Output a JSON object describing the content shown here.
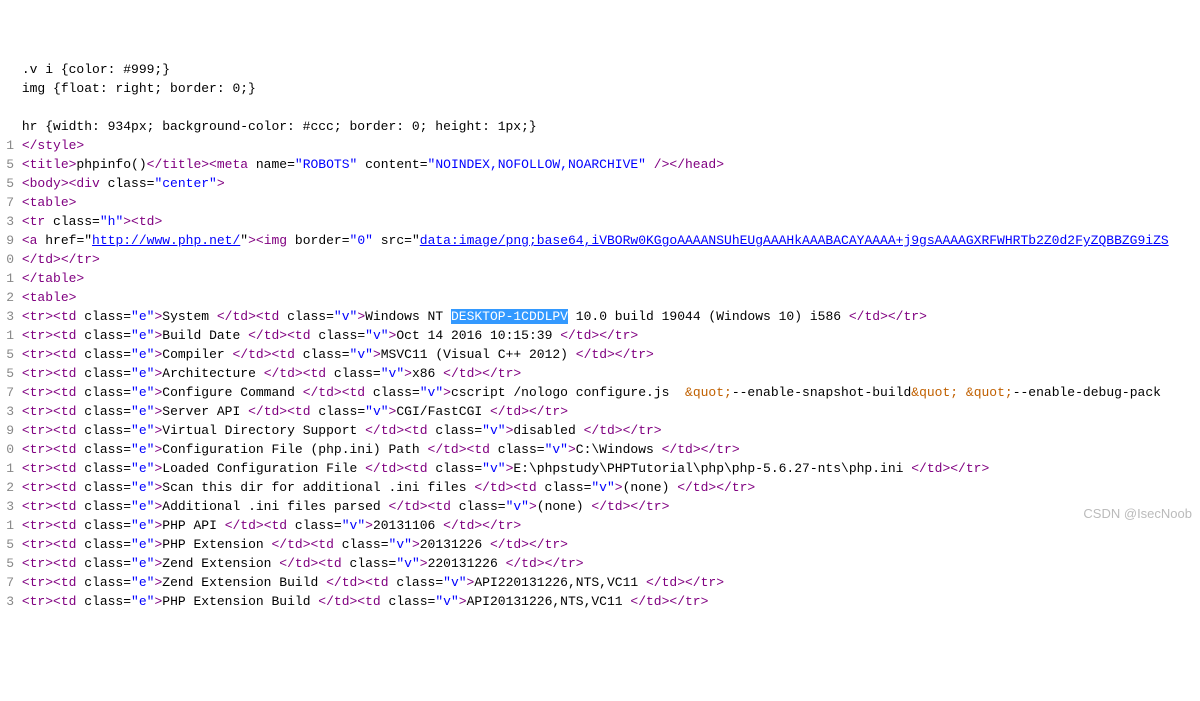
{
  "watermark": "CSDN @IsecNoob",
  "selected_text": "DESKTOP-1CDDLPV",
  "lines": [
    {
      "g": "",
      "parts": [
        {
          "c": "txt",
          "t": ".v i {color: #999;}"
        }
      ]
    },
    {
      "g": "",
      "parts": [
        {
          "c": "txt",
          "t": "img {float: right; border: 0;}"
        }
      ]
    },
    {
      "g": "",
      "parts": []
    },
    {
      "g": "",
      "parts": [
        {
          "c": "txt",
          "t": "hr {width: 934px; background-color: #ccc; border: 0; height: 1px;}"
        }
      ]
    },
    {
      "g": "1",
      "parts": [
        {
          "c": "tag",
          "t": "</style>"
        }
      ]
    },
    {
      "g": "5",
      "parts": [
        {
          "c": "tag",
          "t": "<title>"
        },
        {
          "c": "txt",
          "t": "phpinfo()"
        },
        {
          "c": "tag",
          "t": "</title><meta"
        },
        {
          "c": "attr-name",
          "t": " name"
        },
        {
          "c": "txt",
          "t": "="
        },
        {
          "c": "attr-val",
          "t": "\"ROBOTS\""
        },
        {
          "c": "attr-name",
          "t": " content"
        },
        {
          "c": "txt",
          "t": "="
        },
        {
          "c": "attr-val",
          "t": "\"NOINDEX,NOFOLLOW,NOARCHIVE\""
        },
        {
          "c": "tag",
          "t": " /></head>"
        }
      ]
    },
    {
      "g": "5",
      "parts": [
        {
          "c": "tag",
          "t": "<body><div"
        },
        {
          "c": "attr-name",
          "t": " class"
        },
        {
          "c": "txt",
          "t": "="
        },
        {
          "c": "attr-val",
          "t": "\"center\""
        },
        {
          "c": "tag",
          "t": ">"
        }
      ]
    },
    {
      "g": "7",
      "parts": [
        {
          "c": "tag",
          "t": "<table>"
        }
      ]
    },
    {
      "g": "3",
      "parts": [
        {
          "c": "tag",
          "t": "<tr"
        },
        {
          "c": "attr-name",
          "t": " class"
        },
        {
          "c": "txt",
          "t": "="
        },
        {
          "c": "attr-val",
          "t": "\"h\""
        },
        {
          "c": "tag",
          "t": "><td>"
        }
      ]
    },
    {
      "g": "9",
      "parts": [
        {
          "c": "tag",
          "t": "<a"
        },
        {
          "c": "attr-name",
          "t": " href"
        },
        {
          "c": "txt",
          "t": "=\""
        },
        {
          "c": "link",
          "t": "http://www.php.net/"
        },
        {
          "c": "txt",
          "t": "\""
        },
        {
          "c": "tag",
          "t": "><img"
        },
        {
          "c": "attr-name",
          "t": " border"
        },
        {
          "c": "txt",
          "t": "="
        },
        {
          "c": "attr-val",
          "t": "\"0\""
        },
        {
          "c": "attr-name",
          "t": " src"
        },
        {
          "c": "txt",
          "t": "=\""
        },
        {
          "c": "link",
          "t": "data:image/png;base64,iVBORw0KGgoAAAANSUhEUgAAAHkAAABACAYAAAA+j9gsAAAAGXRFWHRTb2Z0d2FyZQBBZG9iZS"
        }
      ]
    },
    {
      "g": "0",
      "parts": [
        {
          "c": "tag",
          "t": "</td></tr>"
        }
      ]
    },
    {
      "g": "1",
      "parts": [
        {
          "c": "tag",
          "t": "</table>"
        }
      ]
    },
    {
      "g": "2",
      "parts": [
        {
          "c": "tag",
          "t": "<table>"
        }
      ]
    },
    {
      "g": "3",
      "parts": [
        {
          "c": "tag",
          "t": "<tr><td"
        },
        {
          "c": "attr-name",
          "t": " class"
        },
        {
          "c": "txt",
          "t": "="
        },
        {
          "c": "attr-val",
          "t": "\"e\""
        },
        {
          "c": "tag",
          "t": ">"
        },
        {
          "c": "txt",
          "t": "System "
        },
        {
          "c": "tag",
          "t": "</td><td"
        },
        {
          "c": "attr-name",
          "t": " class"
        },
        {
          "c": "txt",
          "t": "="
        },
        {
          "c": "attr-val",
          "t": "\"v\""
        },
        {
          "c": "tag",
          "t": ">"
        },
        {
          "c": "txt",
          "t": "Windows NT "
        },
        {
          "c": "sel",
          "t": "DESKTOP-1CDDLPV"
        },
        {
          "c": "txt",
          "t": " 10.0 build 19044 (Windows 10) i586 "
        },
        {
          "c": "tag",
          "t": "</td></tr>"
        }
      ]
    },
    {
      "g": "1",
      "parts": [
        {
          "c": "tag",
          "t": "<tr><td"
        },
        {
          "c": "attr-name",
          "t": " class"
        },
        {
          "c": "txt",
          "t": "="
        },
        {
          "c": "attr-val",
          "t": "\"e\""
        },
        {
          "c": "tag",
          "t": ">"
        },
        {
          "c": "txt",
          "t": "Build Date "
        },
        {
          "c": "tag",
          "t": "</td><td"
        },
        {
          "c": "attr-name",
          "t": " class"
        },
        {
          "c": "txt",
          "t": "="
        },
        {
          "c": "attr-val",
          "t": "\"v\""
        },
        {
          "c": "tag",
          "t": ">"
        },
        {
          "c": "txt",
          "t": "Oct 14 2016 10:15:39 "
        },
        {
          "c": "tag",
          "t": "</td></tr>"
        }
      ]
    },
    {
      "g": "5",
      "parts": [
        {
          "c": "tag",
          "t": "<tr><td"
        },
        {
          "c": "attr-name",
          "t": " class"
        },
        {
          "c": "txt",
          "t": "="
        },
        {
          "c": "attr-val",
          "t": "\"e\""
        },
        {
          "c": "tag",
          "t": ">"
        },
        {
          "c": "txt",
          "t": "Compiler "
        },
        {
          "c": "tag",
          "t": "</td><td"
        },
        {
          "c": "attr-name",
          "t": " class"
        },
        {
          "c": "txt",
          "t": "="
        },
        {
          "c": "attr-val",
          "t": "\"v\""
        },
        {
          "c": "tag",
          "t": ">"
        },
        {
          "c": "txt",
          "t": "MSVC11 (Visual C++ 2012) "
        },
        {
          "c": "tag",
          "t": "</td></tr>"
        }
      ]
    },
    {
      "g": "5",
      "parts": [
        {
          "c": "tag",
          "t": "<tr><td"
        },
        {
          "c": "attr-name",
          "t": " class"
        },
        {
          "c": "txt",
          "t": "="
        },
        {
          "c": "attr-val",
          "t": "\"e\""
        },
        {
          "c": "tag",
          "t": ">"
        },
        {
          "c": "txt",
          "t": "Architecture "
        },
        {
          "c": "tag",
          "t": "</td><td"
        },
        {
          "c": "attr-name",
          "t": " class"
        },
        {
          "c": "txt",
          "t": "="
        },
        {
          "c": "attr-val",
          "t": "\"v\""
        },
        {
          "c": "tag",
          "t": ">"
        },
        {
          "c": "txt",
          "t": "x86 "
        },
        {
          "c": "tag",
          "t": "</td></tr>"
        }
      ]
    },
    {
      "g": "7",
      "parts": [
        {
          "c": "tag",
          "t": "<tr><td"
        },
        {
          "c": "attr-name",
          "t": " class"
        },
        {
          "c": "txt",
          "t": "="
        },
        {
          "c": "attr-val",
          "t": "\"e\""
        },
        {
          "c": "tag",
          "t": ">"
        },
        {
          "c": "txt",
          "t": "Configure Command "
        },
        {
          "c": "tag",
          "t": "</td><td"
        },
        {
          "c": "attr-name",
          "t": " class"
        },
        {
          "c": "txt",
          "t": "="
        },
        {
          "c": "attr-val",
          "t": "\"v\""
        },
        {
          "c": "tag",
          "t": ">"
        },
        {
          "c": "txt",
          "t": "cscript /nologo configure.js  "
        },
        {
          "c": "ent",
          "t": "&quot;"
        },
        {
          "c": "txt",
          "t": "--enable-snapshot-build"
        },
        {
          "c": "ent",
          "t": "&quot;"
        },
        {
          "c": "txt",
          "t": " "
        },
        {
          "c": "ent",
          "t": "&quot;"
        },
        {
          "c": "txt",
          "t": "--enable-debug-pack"
        }
      ]
    },
    {
      "g": "3",
      "parts": [
        {
          "c": "tag",
          "t": "<tr><td"
        },
        {
          "c": "attr-name",
          "t": " class"
        },
        {
          "c": "txt",
          "t": "="
        },
        {
          "c": "attr-val",
          "t": "\"e\""
        },
        {
          "c": "tag",
          "t": ">"
        },
        {
          "c": "txt",
          "t": "Server API "
        },
        {
          "c": "tag",
          "t": "</td><td"
        },
        {
          "c": "attr-name",
          "t": " class"
        },
        {
          "c": "txt",
          "t": "="
        },
        {
          "c": "attr-val",
          "t": "\"v\""
        },
        {
          "c": "tag",
          "t": ">"
        },
        {
          "c": "txt",
          "t": "CGI/FastCGI "
        },
        {
          "c": "tag",
          "t": "</td></tr>"
        }
      ]
    },
    {
      "g": "9",
      "parts": [
        {
          "c": "tag",
          "t": "<tr><td"
        },
        {
          "c": "attr-name",
          "t": " class"
        },
        {
          "c": "txt",
          "t": "="
        },
        {
          "c": "attr-val",
          "t": "\"e\""
        },
        {
          "c": "tag",
          "t": ">"
        },
        {
          "c": "txt",
          "t": "Virtual Directory Support "
        },
        {
          "c": "tag",
          "t": "</td><td"
        },
        {
          "c": "attr-name",
          "t": " class"
        },
        {
          "c": "txt",
          "t": "="
        },
        {
          "c": "attr-val",
          "t": "\"v\""
        },
        {
          "c": "tag",
          "t": ">"
        },
        {
          "c": "txt",
          "t": "disabled "
        },
        {
          "c": "tag",
          "t": "</td></tr>"
        }
      ]
    },
    {
      "g": "0",
      "parts": [
        {
          "c": "tag",
          "t": "<tr><td"
        },
        {
          "c": "attr-name",
          "t": " class"
        },
        {
          "c": "txt",
          "t": "="
        },
        {
          "c": "attr-val",
          "t": "\"e\""
        },
        {
          "c": "tag",
          "t": ">"
        },
        {
          "c": "txt",
          "t": "Configuration File (php.ini) Path "
        },
        {
          "c": "tag",
          "t": "</td><td"
        },
        {
          "c": "attr-name",
          "t": " class"
        },
        {
          "c": "txt",
          "t": "="
        },
        {
          "c": "attr-val",
          "t": "\"v\""
        },
        {
          "c": "tag",
          "t": ">"
        },
        {
          "c": "txt",
          "t": "C:\\Windows "
        },
        {
          "c": "tag",
          "t": "</td></tr>"
        }
      ]
    },
    {
      "g": "1",
      "parts": [
        {
          "c": "tag",
          "t": "<tr><td"
        },
        {
          "c": "attr-name",
          "t": " class"
        },
        {
          "c": "txt",
          "t": "="
        },
        {
          "c": "attr-val",
          "t": "\"e\""
        },
        {
          "c": "tag",
          "t": ">"
        },
        {
          "c": "txt",
          "t": "Loaded Configuration File "
        },
        {
          "c": "tag",
          "t": "</td><td"
        },
        {
          "c": "attr-name",
          "t": " class"
        },
        {
          "c": "txt",
          "t": "="
        },
        {
          "c": "attr-val",
          "t": "\"v\""
        },
        {
          "c": "tag",
          "t": ">"
        },
        {
          "c": "txt",
          "t": "E:\\phpstudy\\PHPTutorial\\php\\php-5.6.27-nts\\php.ini "
        },
        {
          "c": "tag",
          "t": "</td></tr>"
        }
      ]
    },
    {
      "g": "2",
      "parts": [
        {
          "c": "tag",
          "t": "<tr><td"
        },
        {
          "c": "attr-name",
          "t": " class"
        },
        {
          "c": "txt",
          "t": "="
        },
        {
          "c": "attr-val",
          "t": "\"e\""
        },
        {
          "c": "tag",
          "t": ">"
        },
        {
          "c": "txt",
          "t": "Scan this dir for additional .ini files "
        },
        {
          "c": "tag",
          "t": "</td><td"
        },
        {
          "c": "attr-name",
          "t": " class"
        },
        {
          "c": "txt",
          "t": "="
        },
        {
          "c": "attr-val",
          "t": "\"v\""
        },
        {
          "c": "tag",
          "t": ">"
        },
        {
          "c": "txt",
          "t": "(none) "
        },
        {
          "c": "tag",
          "t": "</td></tr>"
        }
      ]
    },
    {
      "g": "3",
      "parts": [
        {
          "c": "tag",
          "t": "<tr><td"
        },
        {
          "c": "attr-name",
          "t": " class"
        },
        {
          "c": "txt",
          "t": "="
        },
        {
          "c": "attr-val",
          "t": "\"e\""
        },
        {
          "c": "tag",
          "t": ">"
        },
        {
          "c": "txt",
          "t": "Additional .ini files parsed "
        },
        {
          "c": "tag",
          "t": "</td><td"
        },
        {
          "c": "attr-name",
          "t": " class"
        },
        {
          "c": "txt",
          "t": "="
        },
        {
          "c": "attr-val",
          "t": "\"v\""
        },
        {
          "c": "tag",
          "t": ">"
        },
        {
          "c": "txt",
          "t": "(none) "
        },
        {
          "c": "tag",
          "t": "</td></tr>"
        }
      ]
    },
    {
      "g": "1",
      "parts": [
        {
          "c": "tag",
          "t": "<tr><td"
        },
        {
          "c": "attr-name",
          "t": " class"
        },
        {
          "c": "txt",
          "t": "="
        },
        {
          "c": "attr-val",
          "t": "\"e\""
        },
        {
          "c": "tag",
          "t": ">"
        },
        {
          "c": "txt",
          "t": "PHP API "
        },
        {
          "c": "tag",
          "t": "</td><td"
        },
        {
          "c": "attr-name",
          "t": " class"
        },
        {
          "c": "txt",
          "t": "="
        },
        {
          "c": "attr-val",
          "t": "\"v\""
        },
        {
          "c": "tag",
          "t": ">"
        },
        {
          "c": "txt",
          "t": "20131106 "
        },
        {
          "c": "tag",
          "t": "</td></tr>"
        }
      ]
    },
    {
      "g": "5",
      "parts": [
        {
          "c": "tag",
          "t": "<tr><td"
        },
        {
          "c": "attr-name",
          "t": " class"
        },
        {
          "c": "txt",
          "t": "="
        },
        {
          "c": "attr-val",
          "t": "\"e\""
        },
        {
          "c": "tag",
          "t": ">"
        },
        {
          "c": "txt",
          "t": "PHP Extension "
        },
        {
          "c": "tag",
          "t": "</td><td"
        },
        {
          "c": "attr-name",
          "t": " class"
        },
        {
          "c": "txt",
          "t": "="
        },
        {
          "c": "attr-val",
          "t": "\"v\""
        },
        {
          "c": "tag",
          "t": ">"
        },
        {
          "c": "txt",
          "t": "20131226 "
        },
        {
          "c": "tag",
          "t": "</td></tr>"
        }
      ]
    },
    {
      "g": "5",
      "parts": [
        {
          "c": "tag",
          "t": "<tr><td"
        },
        {
          "c": "attr-name",
          "t": " class"
        },
        {
          "c": "txt",
          "t": "="
        },
        {
          "c": "attr-val",
          "t": "\"e\""
        },
        {
          "c": "tag",
          "t": ">"
        },
        {
          "c": "txt",
          "t": "Zend Extension "
        },
        {
          "c": "tag",
          "t": "</td><td"
        },
        {
          "c": "attr-name",
          "t": " class"
        },
        {
          "c": "txt",
          "t": "="
        },
        {
          "c": "attr-val",
          "t": "\"v\""
        },
        {
          "c": "tag",
          "t": ">"
        },
        {
          "c": "txt",
          "t": "220131226 "
        },
        {
          "c": "tag",
          "t": "</td></tr>"
        }
      ]
    },
    {
      "g": "7",
      "parts": [
        {
          "c": "tag",
          "t": "<tr><td"
        },
        {
          "c": "attr-name",
          "t": " class"
        },
        {
          "c": "txt",
          "t": "="
        },
        {
          "c": "attr-val",
          "t": "\"e\""
        },
        {
          "c": "tag",
          "t": ">"
        },
        {
          "c": "txt",
          "t": "Zend Extension Build "
        },
        {
          "c": "tag",
          "t": "</td><td"
        },
        {
          "c": "attr-name",
          "t": " class"
        },
        {
          "c": "txt",
          "t": "="
        },
        {
          "c": "attr-val",
          "t": "\"v\""
        },
        {
          "c": "tag",
          "t": ">"
        },
        {
          "c": "txt",
          "t": "API220131226,NTS,VC11 "
        },
        {
          "c": "tag",
          "t": "</td></tr>"
        }
      ]
    },
    {
      "g": "3",
      "parts": [
        {
          "c": "tag",
          "t": "<tr><td"
        },
        {
          "c": "attr-name",
          "t": " class"
        },
        {
          "c": "txt",
          "t": "="
        },
        {
          "c": "attr-val",
          "t": "\"e\""
        },
        {
          "c": "tag",
          "t": ">"
        },
        {
          "c": "txt",
          "t": "PHP Extension Build "
        },
        {
          "c": "tag",
          "t": "</td><td"
        },
        {
          "c": "attr-name",
          "t": " class"
        },
        {
          "c": "txt",
          "t": "="
        },
        {
          "c": "attr-val",
          "t": "\"v\""
        },
        {
          "c": "tag",
          "t": ">"
        },
        {
          "c": "txt",
          "t": "API20131226,NTS,VC11 "
        },
        {
          "c": "tag",
          "t": "</td></tr>"
        }
      ]
    }
  ]
}
